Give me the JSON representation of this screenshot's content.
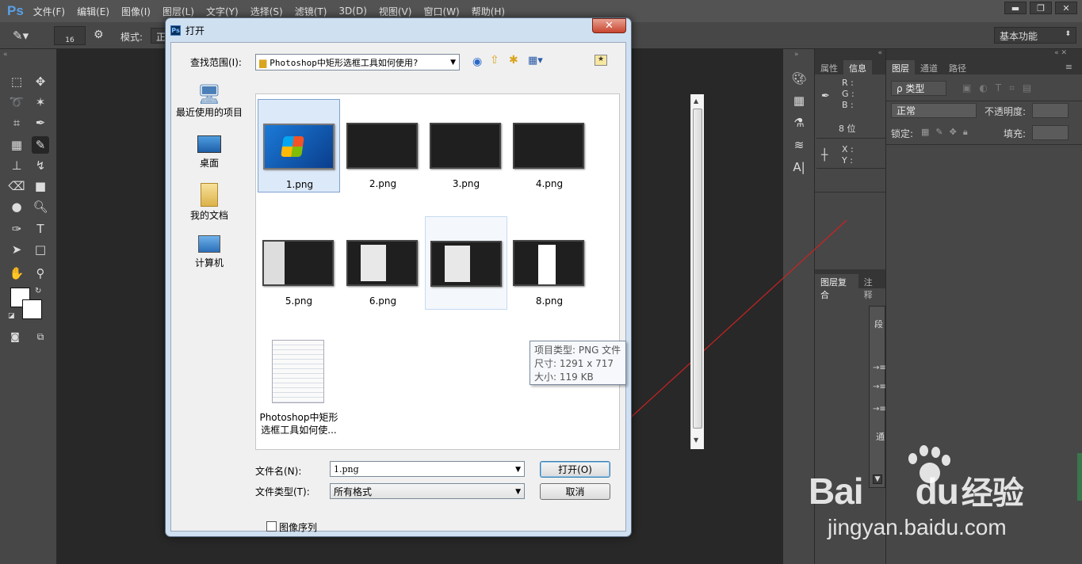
{
  "menubar": {
    "logo": "Ps",
    "items": [
      "文件(F)",
      "编辑(E)",
      "图像(I)",
      "图层(L)",
      "文字(Y)",
      "选择(S)",
      "滤镜(T)",
      "3D(D)",
      "视图(V)",
      "窗口(W)",
      "帮助(H)"
    ],
    "window_buttons": [
      "▬",
      "❐",
      "✕"
    ]
  },
  "optionsbar": {
    "brush_size": "16",
    "mode_label": "模式:",
    "mode_value": "正",
    "workspace": "基本功能"
  },
  "info_panel": {
    "tabs": [
      "属性",
      "信息"
    ],
    "r": "R :",
    "g": "G :",
    "b": "B :",
    "bits": "8 位",
    "x": "X :",
    "y": "Y :"
  },
  "layer_comp_panel": {
    "tabs": [
      "图层复合",
      "注释"
    ]
  },
  "paragraph_panel": {
    "label": "段",
    "pass": "通"
  },
  "layers_panel": {
    "tabs": [
      "图层",
      "通道",
      "路径"
    ],
    "filter_kind": "ρ 类型",
    "blend_mode": "正常",
    "opacity_label": "不透明度:",
    "lock_label": "锁定:",
    "fill_label": "填充:"
  },
  "dialog": {
    "title": "打开",
    "look_in_label": "查找范围(I):",
    "look_in_value": "Photoshop中矩形选框工具如何使用?",
    "places": [
      "最近使用的项目",
      "桌面",
      "我的文档",
      "计算机"
    ],
    "files": [
      {
        "name": "1.png"
      },
      {
        "name": "2.png"
      },
      {
        "name": "3.png"
      },
      {
        "name": "4.png"
      },
      {
        "name": "5.png"
      },
      {
        "name": "6.png"
      },
      {
        "name": ""
      },
      {
        "name": "8.png"
      },
      {
        "name": "Photoshop中矩形选框工具如何使..."
      }
    ],
    "folder_name_line1": "Photoshop中矩形",
    "folder_name_line2": "选框工具如何使...",
    "tooltip": {
      "type": "项目类型: PNG 文件",
      "size": "尺寸: 1291 x 717",
      "filesize": "大小: 119 KB"
    },
    "filename_label": "文件名(N):",
    "filename_value": "1.png",
    "filetype_label": "文件类型(T):",
    "filetype_value": "所有格式",
    "open_button": "打开(O)",
    "cancel_button": "取消",
    "image_sequence": "图像序列"
  },
  "watermark": {
    "brand": "Bai",
    "brand2": "du",
    "suffix": "经验",
    "url": "jingyan.baidu.com"
  },
  "colors": {
    "accent_arrow": "#cc2222",
    "ps_blue": "#5aa0e6"
  }
}
